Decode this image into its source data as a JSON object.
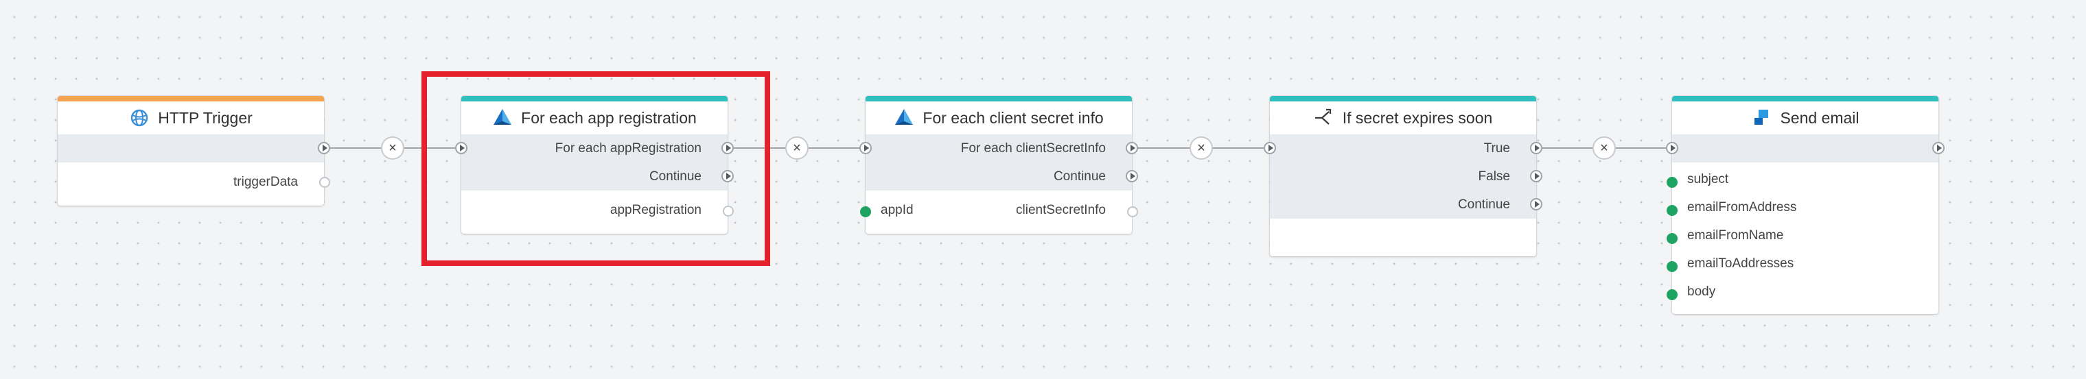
{
  "colors": {
    "trigger_accent": "#f4a350",
    "action_accent": "#2fbfbe",
    "selection": "#e4202a",
    "input_port": "#1ea362"
  },
  "nodes": {
    "http_trigger": {
      "title": "HTTP Trigger",
      "icon": "globe-icon",
      "props": [
        "triggerData"
      ]
    },
    "for_each_app": {
      "title": "For each app registration",
      "icon": "azure-ad-icon",
      "outputs": [
        "For each appRegistration",
        "Continue"
      ],
      "props": [
        "appRegistration"
      ]
    },
    "for_each_secret": {
      "title": "For each client secret info",
      "icon": "azure-ad-icon",
      "outputs": [
        "For each clientSecretInfo",
        "Continue"
      ],
      "inputs": [
        {
          "name": "appId",
          "output": "clientSecretInfo"
        }
      ]
    },
    "if_expires": {
      "title": "If secret expires soon",
      "icon": "branch-icon",
      "outputs": [
        "True",
        "False",
        "Continue"
      ]
    },
    "send_email": {
      "title": "Send email",
      "icon": "email-service-icon",
      "inputs": [
        "subject",
        "emailFromAddress",
        "emailFromName",
        "emailToAddresses",
        "body"
      ]
    }
  },
  "connections": [
    {
      "from": "HTTP Trigger",
      "to": "For each app registration"
    },
    {
      "from": "For each app registration",
      "to": "For each client secret info"
    },
    {
      "from": "For each client secret info",
      "to": "If secret expires soon"
    },
    {
      "from": "If secret expires soon",
      "to": "Send email"
    }
  ],
  "selected_node": "For each app registration"
}
